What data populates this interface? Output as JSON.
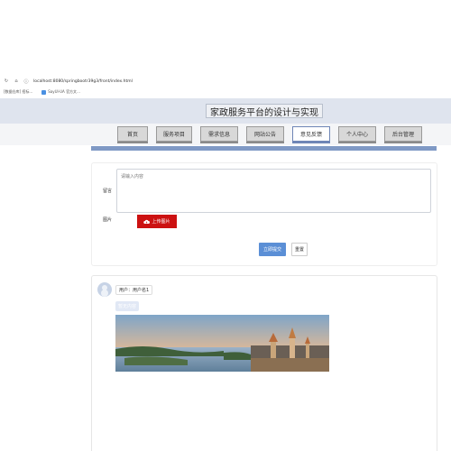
{
  "browser": {
    "url": "localhost:8080/springbootr39g3/front/index.html",
    "bookmarks": [
      "[数据仓库] 招标...",
      "SayUI-UA 官方文..."
    ]
  },
  "site": {
    "title": "家政服务平台的设计与实现"
  },
  "nav": {
    "items": [
      "首页",
      "服务项目",
      "需求信息",
      "网站公告",
      "意见反馈",
      "个人中心",
      "后台管理"
    ],
    "active_index": 4
  },
  "form": {
    "message_label": "留言",
    "message_placeholder": "请输入内容",
    "image_label": "图片",
    "upload_label": "上传图片",
    "submit_label": "立即提交",
    "reset_label": "重置"
  },
  "comment": {
    "username": "用户：用户名1",
    "reply_tag": "暂无内容"
  },
  "colors": {
    "accent": "#7f99c5",
    "header_bg": "#dfe4ee",
    "upload_red": "#cc1111",
    "submit_blue": "#5b8fd6"
  }
}
